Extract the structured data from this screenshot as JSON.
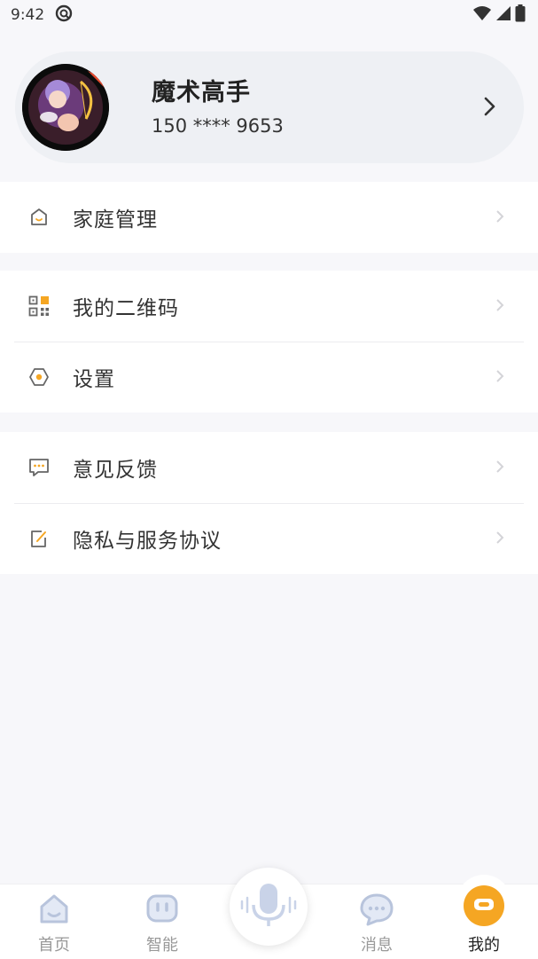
{
  "status_bar": {
    "time": "9:42",
    "icons": [
      "sync-icon",
      "wifi-icon",
      "signal-icon",
      "battery-icon"
    ]
  },
  "profile": {
    "name": "魔术高手",
    "phone": "150 **** 9653"
  },
  "menu_groups": [
    {
      "items": [
        {
          "label": "家庭管理",
          "icon": "home-icon"
        }
      ]
    },
    {
      "items": [
        {
          "label": "我的二维码",
          "icon": "qr-code-icon"
        },
        {
          "label": "设置",
          "icon": "settings-icon"
        }
      ]
    },
    {
      "items": [
        {
          "label": "意见反馈",
          "icon": "feedback-icon"
        },
        {
          "label": "隐私与服务协议",
          "icon": "privacy-icon"
        }
      ]
    }
  ],
  "tabbar": {
    "tabs": [
      {
        "label": "首页",
        "icon": "home-tab-icon",
        "active": false
      },
      {
        "label": "智能",
        "icon": "robot-icon",
        "active": false
      },
      {
        "label": "消息",
        "icon": "message-icon",
        "active": false
      },
      {
        "label": "我的",
        "icon": "profile-tab-icon",
        "active": true
      }
    ],
    "center": {
      "icon": "microphone-icon"
    }
  },
  "colors": {
    "accent": "#f5a623",
    "background": "#f7f7fa",
    "card": "#eef0f4",
    "inactive_tab": "#b8c4dc",
    "text_primary": "#222222",
    "text_muted": "#999999"
  }
}
